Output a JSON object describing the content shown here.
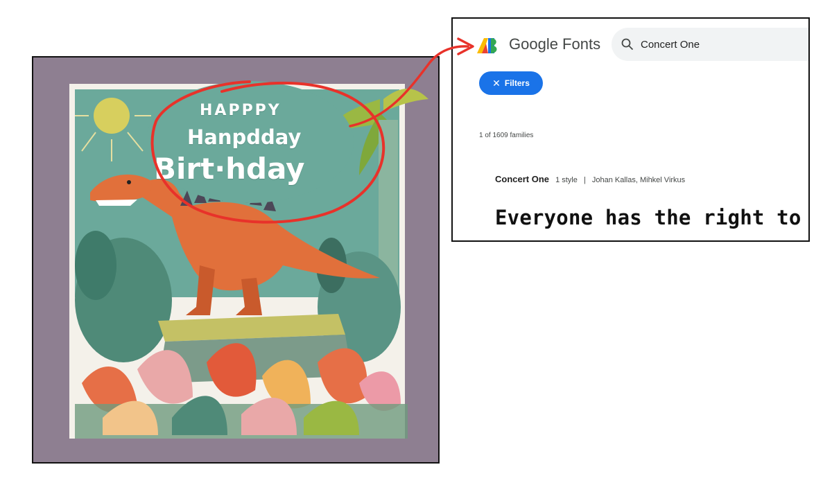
{
  "card": {
    "line1": "HAPPPY",
    "line2": "Hanpdday",
    "line3": "Birt·hday"
  },
  "google_fonts": {
    "wordmark": "Google Fonts",
    "search_value": "Concert One",
    "filters_label": "Filters",
    "result_count": "1 of 1609 families",
    "family": {
      "name": "Concert One",
      "styles": "1 style",
      "separator": "|",
      "designers": "Johan Kallas, Mihkel Virkus"
    },
    "sample_text": "Everyone has the right to fre"
  },
  "colors": {
    "annotation_red": "#e8322a",
    "filters_blue": "#1a73e8",
    "card_background": "#8e7f91",
    "card_sky": "#6ba99b"
  },
  "icons": {
    "search": "search-icon",
    "close": "close-icon",
    "logo": "google-fonts-logo"
  }
}
